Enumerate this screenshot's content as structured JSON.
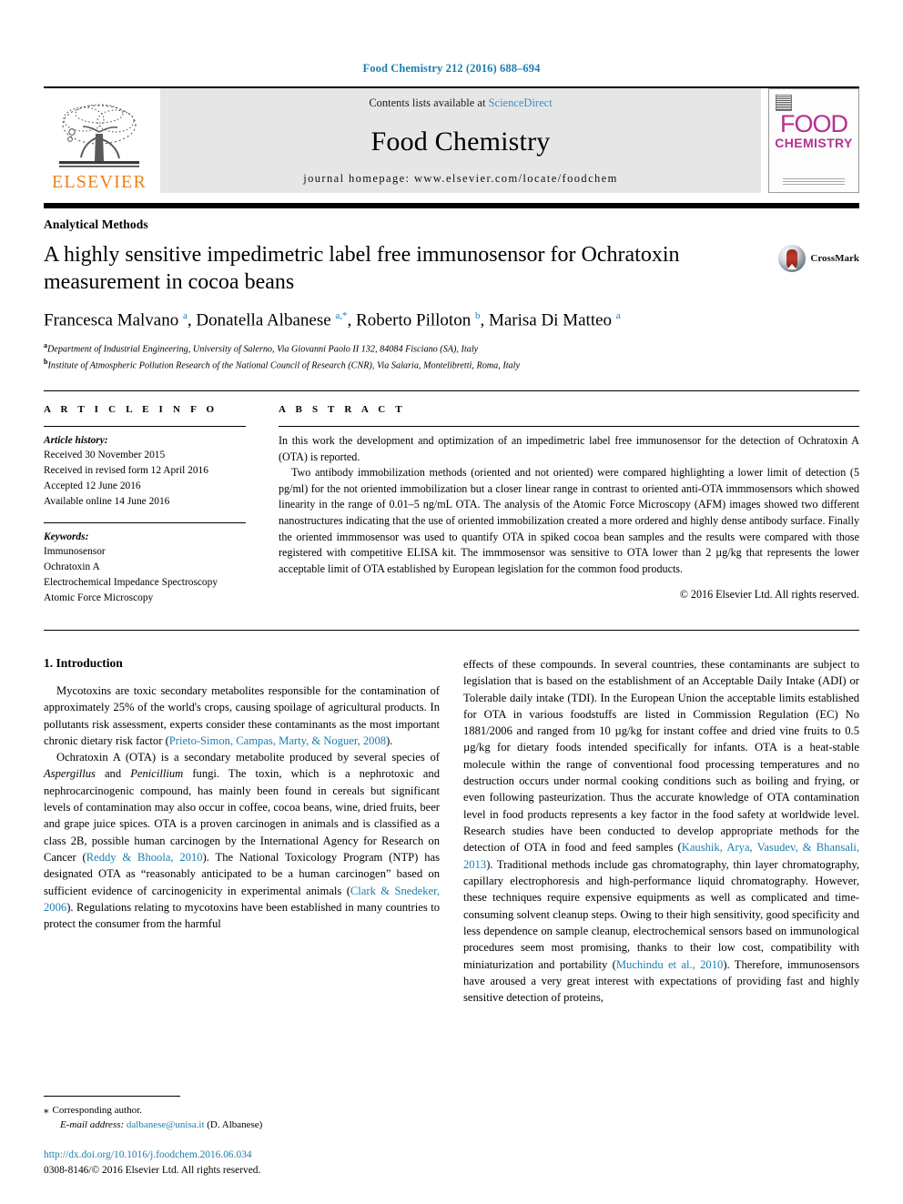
{
  "running_head": "Food Chemistry 212 (2016) 688–694",
  "masthead": {
    "publisher_name": "ELSEVIER",
    "contents_prefix": "Contents lists available at ",
    "contents_link": "ScienceDirect",
    "journal_name": "Food Chemistry",
    "homepage": "journal homepage: www.elsevier.com/locate/foodchem",
    "cover_title_top": "FOOD",
    "cover_title_bottom": "CHEMISTRY"
  },
  "section_type": "Analytical Methods",
  "title": "A highly sensitive impedimetric label free immunosensor for Ochratoxin measurement in cocoa beans",
  "crossmark_label": "CrossMark",
  "authors_html": "Francesca Malvano <sup>a</sup>, Donatella Albanese <sup>a,*</sup>, Roberto Pilloton <sup>b</sup>, Marisa Di Matteo <sup>a</sup>",
  "affiliations": [
    {
      "marker": "a",
      "text": "Department of Industrial Engineering, University of Salerno, Via Giovanni Paolo II 132, 84084 Fisciano (SA), Italy"
    },
    {
      "marker": "b",
      "text": "Institute of Atmospheric Pollution Research of the National Council of Research (CNR), Via Salaria, Montelibretti, Roma, Italy"
    }
  ],
  "article_info": {
    "label": "A R T I C L E  I N F O",
    "history_title": "Article history:",
    "history": [
      "Received 30 November 2015",
      "Received in revised form 12 April 2016",
      "Accepted 12 June 2016",
      "Available online 14 June 2016"
    ],
    "keywords_title": "Keywords:",
    "keywords": [
      "Immunosensor",
      "Ochratoxin A",
      "Electrochemical Impedance Spectroscopy",
      "Atomic Force Microscopy"
    ]
  },
  "abstract": {
    "label": "A B S T R A C T",
    "paragraphs": [
      "In this work the development and optimization of an impedimetric label free immunosensor for the detection of Ochratoxin A (OTA) is reported.",
      "Two antibody immobilization methods (oriented and not oriented) were compared highlighting a lower limit of detection (5 pg/ml) for the not oriented immobilization but a closer linear range in contrast to oriented anti-OTA immmosensors which showed linearity in the range of 0.01–5 ng/mL OTA. The analysis of the Atomic Force Microscopy (AFM) images showed two different nanostructures indicating that the use of oriented immobilization created a more ordered and highly dense antibody surface. Finally the oriented immmosensor was used to quantify OTA in spiked cocoa bean samples and the results were compared with those registered with competitive ELISA kit. The immmosensor was sensitive to OTA lower than 2 µg/kg that represents the lower acceptable limit of OTA established by European legislation for the common food products."
    ],
    "copyright": "© 2016 Elsevier Ltd. All rights reserved."
  },
  "introduction": {
    "heading": "1. Introduction",
    "left_column_html": [
      "Mycotoxins are toxic secondary metabolites responsible for the contamination of approximately 25% of the world's crops, causing spoilage of agricultural products. In pollutants risk assessment, experts consider these contaminants as the most important chronic dietary risk factor (<span class=\"ref\">Prieto-Simon, Campas, Marty, &amp; Noguer, 2008</span>).",
      "Ochratoxin A (OTA) is a secondary metabolite produced by several species of <span class=\"ital\">Aspergillus</span> and <span class=\"ital\">Penicillium</span> fungi. The toxin, which is a nephrotoxic and nephrocarcinogenic compound, has mainly been found in cereals but significant levels of contamination may also occur in coffee, cocoa beans, wine, dried fruits, beer and grape juice spices. OTA is a proven carcinogen in animals and is classified as a class 2B, possible human carcinogen by the International Agency for Research on Cancer (<span class=\"ref\">Reddy &amp; Bhoola, 2010</span>). The National Toxicology Program (NTP) has designated OTA as “reasonably anticipated to be a human carcinogen” based on sufficient evidence of carcinogenicity in experimental animals (<span class=\"ref\">Clark &amp; Snedeker, 2006</span>). Regulations relating to mycotoxins have been established in many countries to protect the consumer from the harmful"
    ],
    "right_column_html": [
      "effects of these compounds. In several countries, these contaminants are subject to legislation that is based on the establishment of an Acceptable Daily Intake (ADI) or Tolerable daily intake (TDI). In the European Union the acceptable limits established for OTA in various foodstuffs are listed in Commission Regulation (EC) No 1881/2006 and ranged from 10 µg/kg for instant coffee and dried vine fruits to 0.5 µg/kg for dietary foods intended specifically for infants. OTA is a heat-stable molecule within the range of conventional food processing temperatures and no destruction occurs under normal cooking conditions such as boiling and frying, or even following pasteurization. Thus the accurate knowledge of OTA contamination level in food products represents a key factor in the food safety at worldwide level. Research studies have been conducted to develop appropriate methods for the detection of OTA in food and feed samples (<span class=\"ref\">Kaushik, Arya, Vasudev, &amp; Bhansali, 2013</span>). Traditional methods include gas chromatography, thin layer chromatography, capillary electrophoresis and high-performance liquid chromatography. However, these techniques require expensive equipments as well as complicated and time-consuming solvent cleanup steps. Owing to their high sensitivity, good specificity and less dependence on sample cleanup, electrochemical sensors based on immunological procedures seem most promising, thanks to their low cost, compatibility with miniaturization and portability (<span class=\"ref\">Muchindu et al., 2010</span>). Therefore, immunosensors have aroused a very great interest with expectations of providing fast and highly sensitive detection of proteins,"
    ]
  },
  "footnotes": {
    "corresponding_marker": "⁎",
    "corresponding_text": "Corresponding author.",
    "email_label": "E-mail address:",
    "email": "dalbanese@unisa.it",
    "email_owner": "(D. Albanese)",
    "doi": "http://dx.doi.org/10.1016/j.foodchem.2016.06.034",
    "issn_line": "0308-8146/© 2016 Elsevier Ltd. All rights reserved."
  },
  "colors": {
    "link": "#1a7eb0",
    "elsevier_orange": "#f07f13",
    "cover_magenta": "#b5308f",
    "band_gray": "#e6e6e6"
  }
}
